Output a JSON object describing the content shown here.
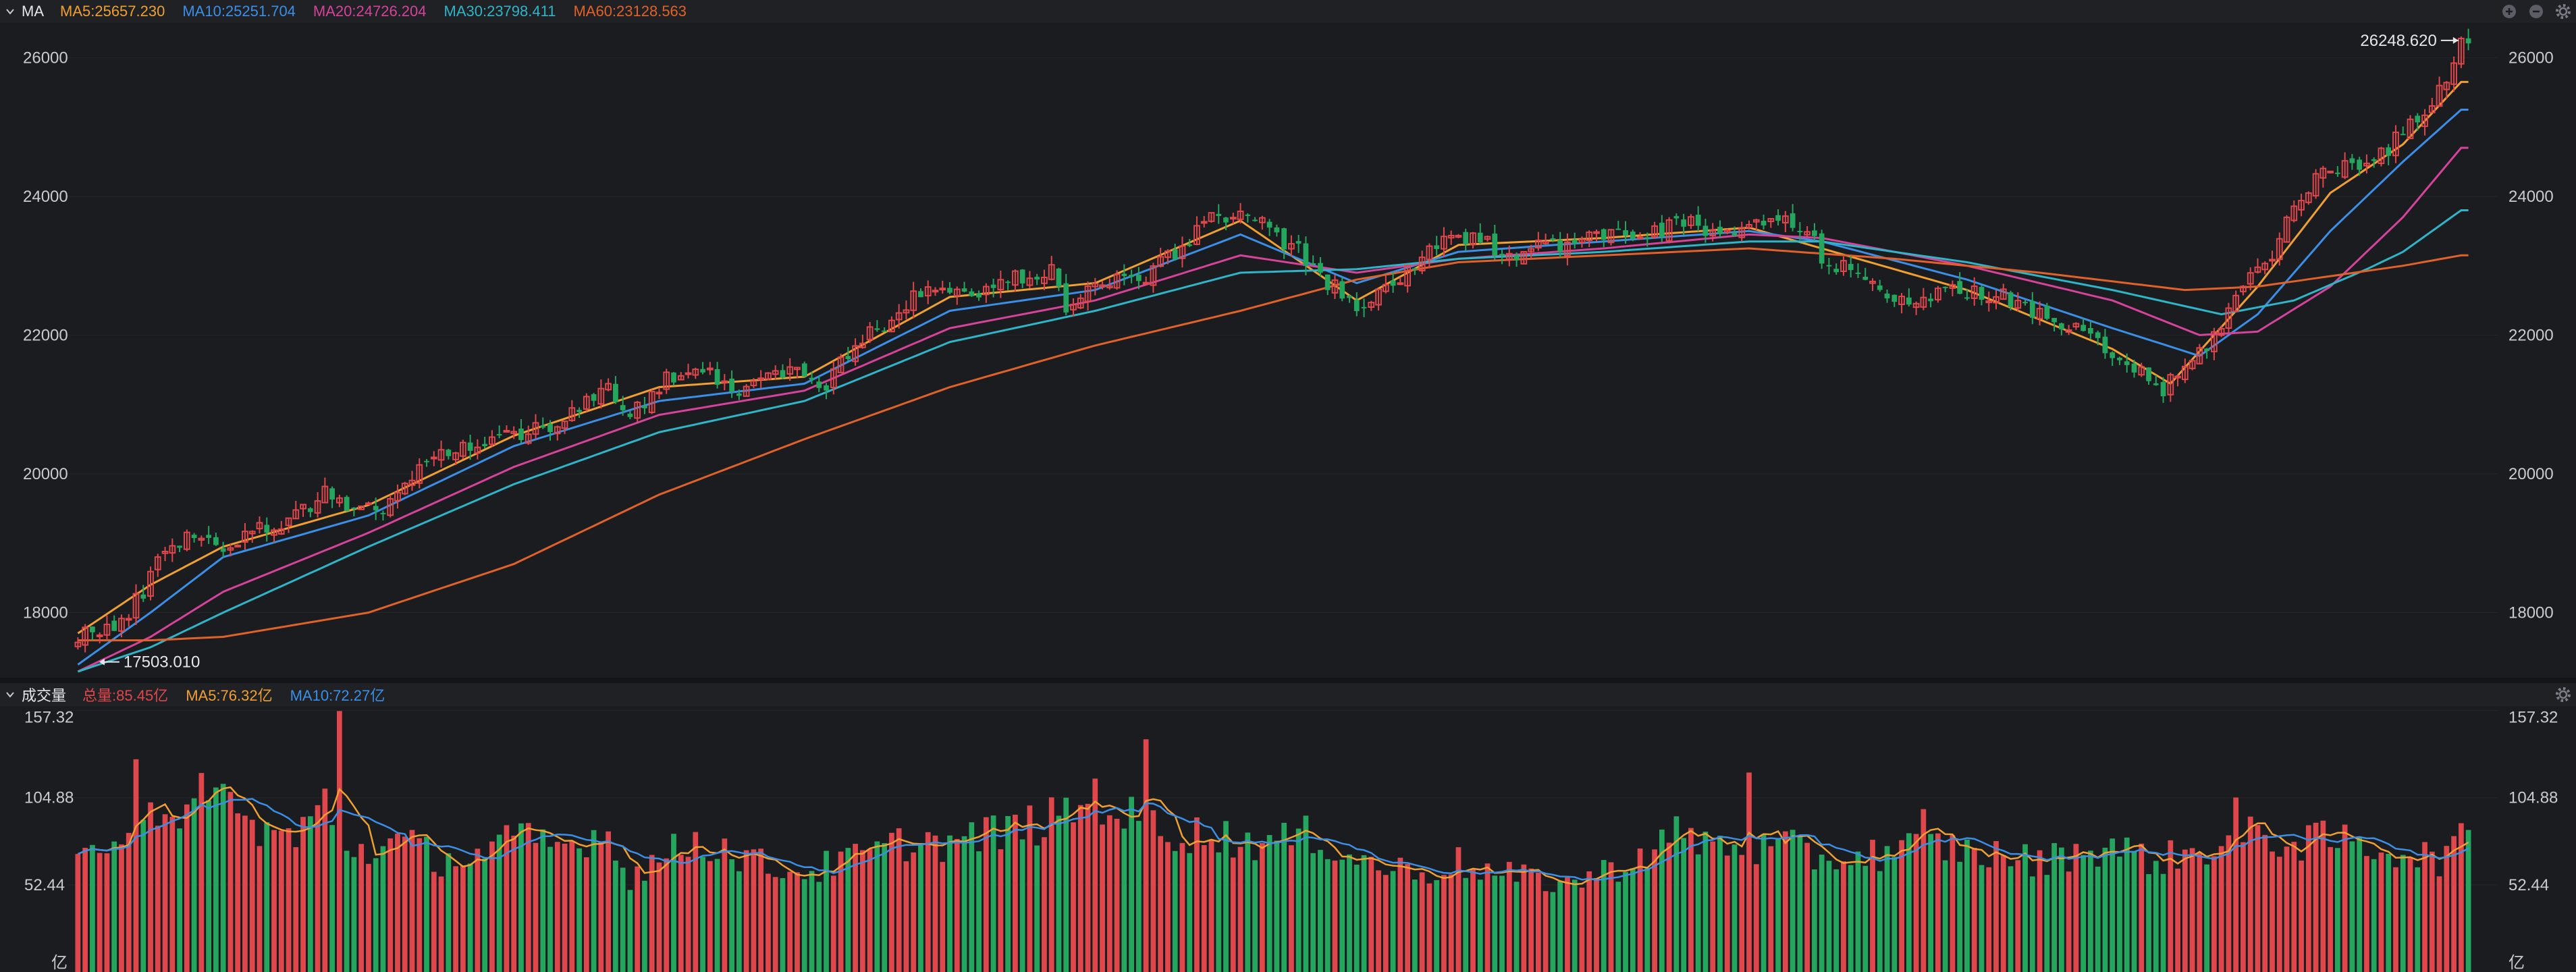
{
  "colors": {
    "background": "#1b1c20",
    "header": "#202125",
    "up": "#e0474c",
    "down": "#25a65f",
    "ma5": "#f0a030",
    "ma10": "#3b8fe6",
    "ma20": "#d5439a",
    "ma30": "#2fb5c8",
    "ma60": "#e0622a"
  },
  "price_panel": {
    "indicator_name": "MA",
    "legend": [
      {
        "id": "ma5",
        "label": "MA5:25657.230"
      },
      {
        "id": "ma10",
        "label": "MA10:25251.704"
      },
      {
        "id": "ma20",
        "label": "MA20:24726.204"
      },
      {
        "id": "ma30",
        "label": "MA30:23798.411"
      },
      {
        "id": "ma60",
        "label": "MA60:23128.563"
      }
    ],
    "header_icons": [
      "add-icon",
      "minus-icon",
      "gear-icon"
    ],
    "y_ticks": [
      "26000",
      "24000",
      "22000",
      "20000",
      "18000"
    ],
    "max_label": "26248.620",
    "min_label": "17503.010"
  },
  "volume_panel": {
    "indicator_name": "成交量",
    "legend": [
      {
        "id": "total",
        "label": "总量:85.45亿"
      },
      {
        "id": "ma5",
        "label": "MA5:76.32亿"
      },
      {
        "id": "ma10",
        "label": "MA10:72.27亿"
      }
    ],
    "header_icons": [
      "gear-icon"
    ],
    "y_ticks": [
      "157.32",
      "104.88",
      "52.44"
    ],
    "unit": "亿"
  },
  "chart_data": [
    {
      "type": "candlestick",
      "ylim": [
        17100,
        26500
      ],
      "y_ticks": [
        26000,
        24000,
        22000,
        20000,
        18000
      ],
      "max_value": 26248.62,
      "min_value": 17503.01,
      "series": [
        {
          "name": "MA5",
          "last": 25657.23
        },
        {
          "name": "MA10",
          "last": 25251.704
        },
        {
          "name": "MA20",
          "last": 24726.204
        },
        {
          "name": "MA30",
          "last": 23798.411
        },
        {
          "name": "MA60",
          "last": 23128.563
        }
      ],
      "path": [
        [
          0,
          17700
        ],
        [
          6,
          17800
        ],
        [
          8,
          18150
        ],
        [
          10,
          18500
        ],
        [
          12,
          18950
        ],
        [
          15,
          19100
        ],
        [
          18,
          19050
        ],
        [
          20,
          18950
        ],
        [
          24,
          19150
        ],
        [
          28,
          19300
        ],
        [
          30,
          19450
        ],
        [
          34,
          19700
        ],
        [
          38,
          19550
        ],
        [
          42,
          19500
        ],
        [
          46,
          19900
        ],
        [
          50,
          20350
        ],
        [
          54,
          20400
        ],
        [
          58,
          20500
        ],
        [
          62,
          20650
        ],
        [
          66,
          20750
        ],
        [
          70,
          21000
        ],
        [
          73,
          21200
        ],
        [
          76,
          20800
        ],
        [
          80,
          21300
        ],
        [
          85,
          21600
        ],
        [
          88,
          21400
        ],
        [
          90,
          21200
        ],
        [
          94,
          21350
        ],
        [
          98,
          21550
        ],
        [
          102,
          21200
        ],
        [
          106,
          21700
        ],
        [
          110,
          22100
        ],
        [
          114,
          22450
        ],
        [
          118,
          22700
        ],
        [
          122,
          22550
        ],
        [
          126,
          22700
        ],
        [
          130,
          22850
        ],
        [
          134,
          22950
        ],
        [
          136,
          22400
        ],
        [
          140,
          22700
        ],
        [
          144,
          22800
        ],
        [
          148,
          22900
        ],
        [
          152,
          23300
        ],
        [
          156,
          23700
        ],
        [
          160,
          23800
        ],
        [
          164,
          23500
        ],
        [
          168,
          23200
        ],
        [
          171,
          22800
        ],
        [
          174,
          22600
        ],
        [
          176,
          22300
        ],
        [
          178,
          22500
        ],
        [
          182,
          22850
        ],
        [
          186,
          23200
        ],
        [
          190,
          23400
        ],
        [
          194,
          23300
        ],
        [
          198,
          23200
        ],
        [
          202,
          23350
        ],
        [
          206,
          23300
        ],
        [
          210,
          23450
        ],
        [
          214,
          23500
        ],
        [
          218,
          23500
        ],
        [
          222,
          23650
        ],
        [
          226,
          23350
        ],
        [
          230,
          23600
        ],
        [
          234,
          23650
        ],
        [
          238,
          23500
        ],
        [
          240,
          23100
        ],
        [
          244,
          22900
        ],
        [
          248,
          22700
        ],
        [
          252,
          22500
        ],
        [
          256,
          22550
        ],
        [
          260,
          22650
        ],
        [
          264,
          22600
        ],
        [
          268,
          22350
        ],
        [
          272,
          22200
        ],
        [
          276,
          22000
        ],
        [
          280,
          21700
        ],
        [
          284,
          21450
        ],
        [
          287,
          21200
        ],
        [
          290,
          21500
        ],
        [
          294,
          22000
        ],
        [
          298,
          22700
        ],
        [
          302,
          23200
        ],
        [
          306,
          24050
        ],
        [
          310,
          24400
        ],
        [
          314,
          24500
        ],
        [
          318,
          24700
        ],
        [
          322,
          25100
        ],
        [
          326,
          25700
        ],
        [
          328,
          26200
        ]
      ],
      "ma_lines": [
        {
          "name": "MA5",
          "points": [
            [
              0,
              17700
            ],
            [
              10,
              18400
            ],
            [
              20,
              18950
            ],
            [
              40,
              19550
            ],
            [
              60,
              20550
            ],
            [
              80,
              21250
            ],
            [
              100,
              21400
            ],
            [
              120,
              22550
            ],
            [
              140,
              22750
            ],
            [
              160,
              23650
            ],
            [
              176,
              22500
            ],
            [
              190,
              23300
            ],
            [
              210,
              23400
            ],
            [
              230,
              23550
            ],
            [
              240,
              23250
            ],
            [
              260,
              22650
            ],
            [
              280,
              21800
            ],
            [
              288,
              21300
            ],
            [
              300,
              22700
            ],
            [
              310,
              24050
            ],
            [
              320,
              24750
            ],
            [
              328,
              25650
            ]
          ]
        },
        {
          "name": "MA10",
          "points": [
            [
              0,
              17250
            ],
            [
              10,
              18000
            ],
            [
              20,
              18800
            ],
            [
              40,
              19400
            ],
            [
              60,
              20400
            ],
            [
              80,
              21050
            ],
            [
              100,
              21300
            ],
            [
              120,
              22350
            ],
            [
              140,
              22650
            ],
            [
              160,
              23450
            ],
            [
              176,
              22750
            ],
            [
              190,
              23200
            ],
            [
              210,
              23350
            ],
            [
              230,
              23500
            ],
            [
              240,
              23350
            ],
            [
              260,
              22800
            ],
            [
              280,
              22100
            ],
            [
              292,
              21700
            ],
            [
              300,
              22300
            ],
            [
              310,
              23500
            ],
            [
              320,
              24500
            ],
            [
              328,
              25250
            ]
          ]
        },
        {
          "name": "MA20",
          "points": [
            [
              0,
              17150
            ],
            [
              10,
              17650
            ],
            [
              20,
              18300
            ],
            [
              40,
              19150
            ],
            [
              60,
              20100
            ],
            [
              80,
              20850
            ],
            [
              100,
              21200
            ],
            [
              120,
              22100
            ],
            [
              140,
              22500
            ],
            [
              160,
              23150
            ],
            [
              176,
              22900
            ],
            [
              190,
              23100
            ],
            [
              210,
              23250
            ],
            [
              230,
              23450
            ],
            [
              240,
              23400
            ],
            [
              260,
              23000
            ],
            [
              280,
              22500
            ],
            [
              292,
              22000
            ],
            [
              300,
              22050
            ],
            [
              310,
              22700
            ],
            [
              320,
              23700
            ],
            [
              328,
              24700
            ]
          ]
        },
        {
          "name": "MA30",
          "points": [
            [
              0,
              17150
            ],
            [
              10,
              17500
            ],
            [
              20,
              18000
            ],
            [
              40,
              18950
            ],
            [
              60,
              19850
            ],
            [
              80,
              20600
            ],
            [
              100,
              21050
            ],
            [
              120,
              21900
            ],
            [
              140,
              22350
            ],
            [
              160,
              22900
            ],
            [
              176,
              22950
            ],
            [
              190,
              23100
            ],
            [
              210,
              23200
            ],
            [
              230,
              23350
            ],
            [
              240,
              23350
            ],
            [
              260,
              23050
            ],
            [
              280,
              22650
            ],
            [
              295,
              22300
            ],
            [
              305,
              22500
            ],
            [
              315,
              22950
            ],
            [
              320,
              23200
            ],
            [
              328,
              23800
            ]
          ]
        },
        {
          "name": "MA60",
          "points": [
            [
              0,
              17600
            ],
            [
              10,
              17600
            ],
            [
              20,
              17650
            ],
            [
              40,
              18000
            ],
            [
              60,
              18700
            ],
            [
              80,
              19700
            ],
            [
              100,
              20500
            ],
            [
              120,
              21250
            ],
            [
              140,
              21850
            ],
            [
              160,
              22350
            ],
            [
              176,
              22800
            ],
            [
              190,
              23050
            ],
            [
              210,
              23150
            ],
            [
              230,
              23250
            ],
            [
              250,
              23100
            ],
            [
              270,
              22900
            ],
            [
              290,
              22650
            ],
            [
              300,
              22700
            ],
            [
              310,
              22850
            ],
            [
              320,
              23000
            ],
            [
              328,
              23150
            ]
          ]
        }
      ]
    },
    {
      "type": "bar",
      "ylim": [
        0,
        160
      ],
      "y_ticks": [
        157.32,
        104.88,
        52.44
      ],
      "total_last": 85.45,
      "series": [
        {
          "name": "MA5",
          "last": 76.32
        },
        {
          "name": "MA10",
          "last": 72.27
        }
      ],
      "peaks": [
        [
          0,
          65
        ],
        [
          5,
          88
        ],
        [
          10,
          110
        ],
        [
          14,
          80
        ],
        [
          18,
          125
        ],
        [
          22,
          95
        ],
        [
          30,
          82
        ],
        [
          34,
          105
        ],
        [
          38,
          75
        ],
        [
          45,
          80
        ],
        [
          50,
          70
        ],
        [
          55,
          72
        ],
        [
          60,
          82
        ],
        [
          64,
          80
        ],
        [
          68,
          78
        ],
        [
          72,
          90
        ],
        [
          76,
          60
        ],
        [
          80,
          70
        ],
        [
          85,
          82
        ],
        [
          90,
          75
        ],
        [
          95,
          65
        ],
        [
          100,
          62
        ],
        [
          105,
          68
        ],
        [
          110,
          75
        ],
        [
          115,
          82
        ],
        [
          120,
          80
        ],
        [
          125,
          85
        ],
        [
          130,
          90
        ],
        [
          135,
          95
        ],
        [
          140,
          110
        ],
        [
          145,
          95
        ],
        [
          150,
          88
        ],
        [
          155,
          85
        ],
        [
          160,
          82
        ],
        [
          165,
          80
        ],
        [
          170,
          85
        ],
        [
          175,
          72
        ],
        [
          180,
          65
        ],
        [
          185,
          62
        ],
        [
          190,
          68
        ],
        [
          195,
          60
        ],
        [
          200,
          58
        ],
        [
          205,
          55
        ],
        [
          210,
          62
        ],
        [
          215,
          72
        ],
        [
          220,
          85
        ],
        [
          225,
          80
        ],
        [
          230,
          75
        ],
        [
          235,
          78
        ],
        [
          240,
          70
        ],
        [
          245,
          72
        ],
        [
          250,
          75
        ],
        [
          255,
          80
        ],
        [
          260,
          75
        ],
        [
          265,
          72
        ],
        [
          270,
          68
        ],
        [
          275,
          75
        ],
        [
          280,
          78
        ],
        [
          285,
          70
        ],
        [
          290,
          72
        ],
        [
          295,
          80
        ],
        [
          300,
          85
        ],
        [
          305,
          80
        ],
        [
          310,
          82
        ],
        [
          315,
          78
        ],
        [
          320,
          75
        ],
        [
          325,
          70
        ],
        [
          328,
          80
        ]
      ],
      "spikes": [
        [
          8,
          128
        ],
        [
          36,
          157
        ],
        [
          147,
          140
        ],
        [
          230,
          120
        ],
        [
          254,
          98
        ],
        [
          297,
          105
        ]
      ]
    }
  ]
}
